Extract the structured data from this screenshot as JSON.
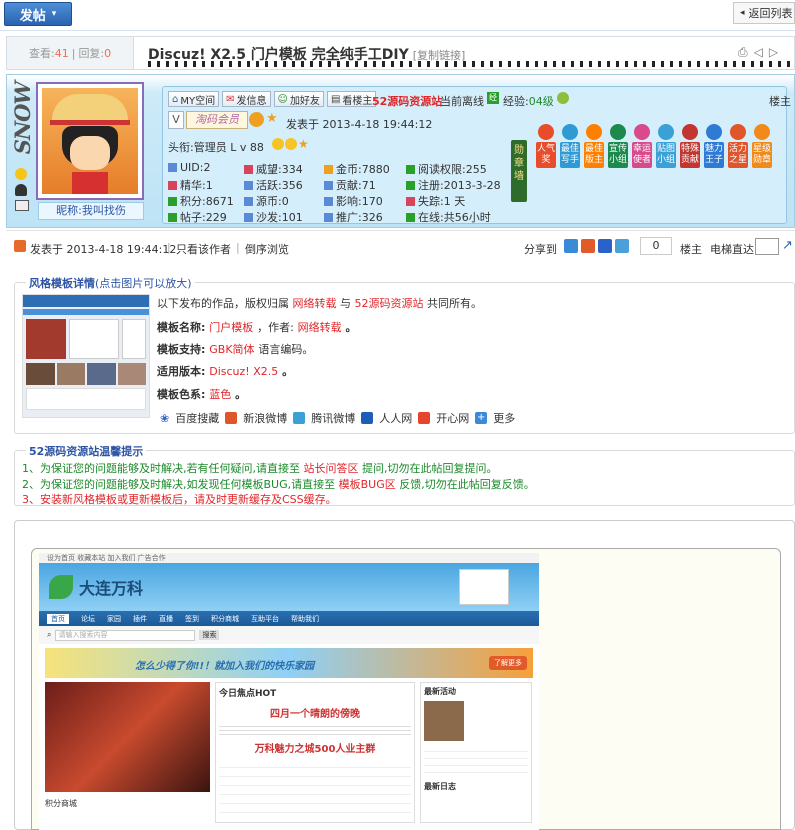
{
  "header": {
    "post_button": "发帖",
    "post_arrow": "▾",
    "back_button": "返回列表",
    "back_arrow": "◂"
  },
  "thread": {
    "views_label": "查看:",
    "views": "41",
    "replies_label": "回复:",
    "replies": "0",
    "title": "Discuz! X2.5 门户模板 完全纯手工DIY",
    "copy_link": "[复制链接]"
  },
  "profile": {
    "signature": "SNOW",
    "nickname": "昵称:我叫找伤",
    "buttons": [
      "MY空间",
      "发信息",
      "加好友",
      "看楼主"
    ],
    "site": "52源码资源站",
    "status": "当前离线",
    "exp_label": "经验:",
    "exp_value": "04级",
    "floor": "楼主",
    "vip": "V",
    "member_badge": "淘码会员",
    "posted": "发表于  2013-4-18 19:44:12",
    "rank": "头衔:管理员 L v 88",
    "stats": [
      [
        "UID:2",
        "威望:334",
        "金币:7880",
        "阅读权限:255"
      ],
      [
        "精华:1",
        "活跃:356",
        "贡献:71",
        "注册:2013-3-28"
      ],
      [
        "积分:8671",
        "源币:0",
        "影响:170",
        "失踪:1 天"
      ],
      [
        "帖子:229",
        "沙发:101",
        "推广:326",
        "在线:共56小时"
      ]
    ],
    "medal_title": "勋章墙",
    "medals": [
      "人气奖",
      "最佳写手",
      "最佳版主",
      "宣传小组",
      "幸运使者",
      "贴图小组",
      "特殊贡献",
      "魅力王子",
      "活力之星",
      "星级勋章"
    ],
    "medal_colors": [
      "#e94c2b",
      "#2f9ad3",
      "#ff7f00",
      "#1b8a4c",
      "#d94a8c",
      "#3aa0d6",
      "#c2362f",
      "#2f7ad3",
      "#e0552a",
      "#f08a1a"
    ]
  },
  "postbar": {
    "posted": "发表于 2013-4-18 19:44:12",
    "only_author": "只看该作者",
    "reverse": "倒序浏览",
    "share": "分享到",
    "count": "0",
    "floor": "楼主",
    "elevator": "电梯直达"
  },
  "details": {
    "legend": "风格模板详情",
    "legend_hint": "(点击图片可以放大)",
    "intro_pre": "以下发布的作品，版权归属",
    "intro_net": "网络转载",
    "intro_mid": "与",
    "intro_site": "52源码资源站",
    "intro_post": "共同所有。",
    "name_label": "模板名称:",
    "name_value": "门户模板",
    "author_label": "，作者:",
    "author_value": "网络转载",
    "dot": "。",
    "support_label": "模板支持:",
    "support_value": "GBK简体",
    "support_post": "语言编码。",
    "version_label": "适用版本:",
    "version_value": "Discuz! X2.5",
    "version_dot": "。",
    "color_label": "模板色系:",
    "color_value": "蓝色",
    "color_dot": "。",
    "share_links": [
      "百度搜藏",
      "新浪微博",
      "腾讯微博",
      "人人网",
      "开心网",
      "更多"
    ]
  },
  "tips": {
    "legend": "52源码资源站温馨提示",
    "l1a": "1、为保证您的问题能够及时解决,若有任何疑问,请直接至",
    "l1b": "站长问答区",
    "l1c": "提问,切勿在此帖回复提问。",
    "l2a": "2、为保证您的问题能够及时解决,如发现任何模板BUG,请直接至",
    "l2b": "模板BUG区",
    "l2c": "反馈,切勿在此帖回复反馈。",
    "l3": "3、安装新风格模板或更新模板后，请及时更新缓存及CSS缓存。"
  },
  "preview": {
    "top_links": "设为首页  收藏本站  加入我们  广告合作",
    "logo": "大连万科",
    "nav": [
      "首页",
      "论坛",
      "家园",
      "插件",
      "直播",
      "签到",
      "积分商城",
      "互助平台",
      "帮助我们"
    ],
    "search_placeholder": "请输入搜索内容",
    "search_btn": "搜索",
    "banner": "怎么少得了你!!！就加入我们的快乐家园",
    "banner_btn": "了解更多",
    "focus_title": "今日焦点HOT",
    "headline1": "四月一个晴朗的傍晚",
    "headline2": "万科魅力之城500人业主群",
    "side_title1": "最新活动",
    "side_title2": "最新日志",
    "mall": "积分商城"
  }
}
